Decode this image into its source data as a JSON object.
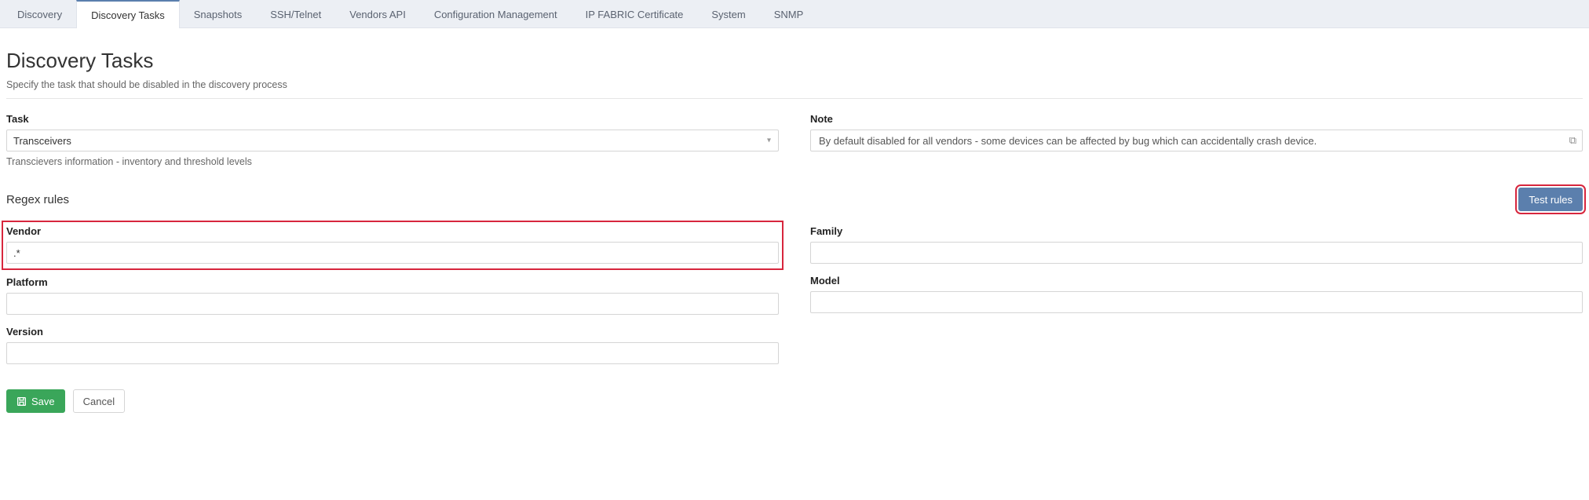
{
  "tabs": {
    "items": [
      {
        "label": "Discovery"
      },
      {
        "label": "Discovery Tasks"
      },
      {
        "label": "Snapshots"
      },
      {
        "label": "SSH/Telnet"
      },
      {
        "label": "Vendors API"
      },
      {
        "label": "Configuration Management"
      },
      {
        "label": "IP FABRIC Certificate"
      },
      {
        "label": "System"
      },
      {
        "label": "SNMP"
      }
    ],
    "activeIndex": 1
  },
  "page": {
    "title": "Discovery Tasks",
    "subtitle": "Specify the task that should be disabled in the discovery process"
  },
  "task": {
    "label": "Task",
    "value": "Transceivers",
    "helper": "Transcievers information - inventory and threshold levels"
  },
  "note": {
    "label": "Note",
    "value": "By default disabled for all vendors - some devices can be affected by bug which can accidentally crash device."
  },
  "regex": {
    "section_title": "Regex rules",
    "test_button": "Test rules",
    "vendor": {
      "label": "Vendor",
      "value": ".*"
    },
    "family": {
      "label": "Family",
      "value": ""
    },
    "platform": {
      "label": "Platform",
      "value": ""
    },
    "model": {
      "label": "Model",
      "value": ""
    },
    "version": {
      "label": "Version",
      "value": ""
    }
  },
  "actions": {
    "save": "Save",
    "cancel": "Cancel"
  }
}
